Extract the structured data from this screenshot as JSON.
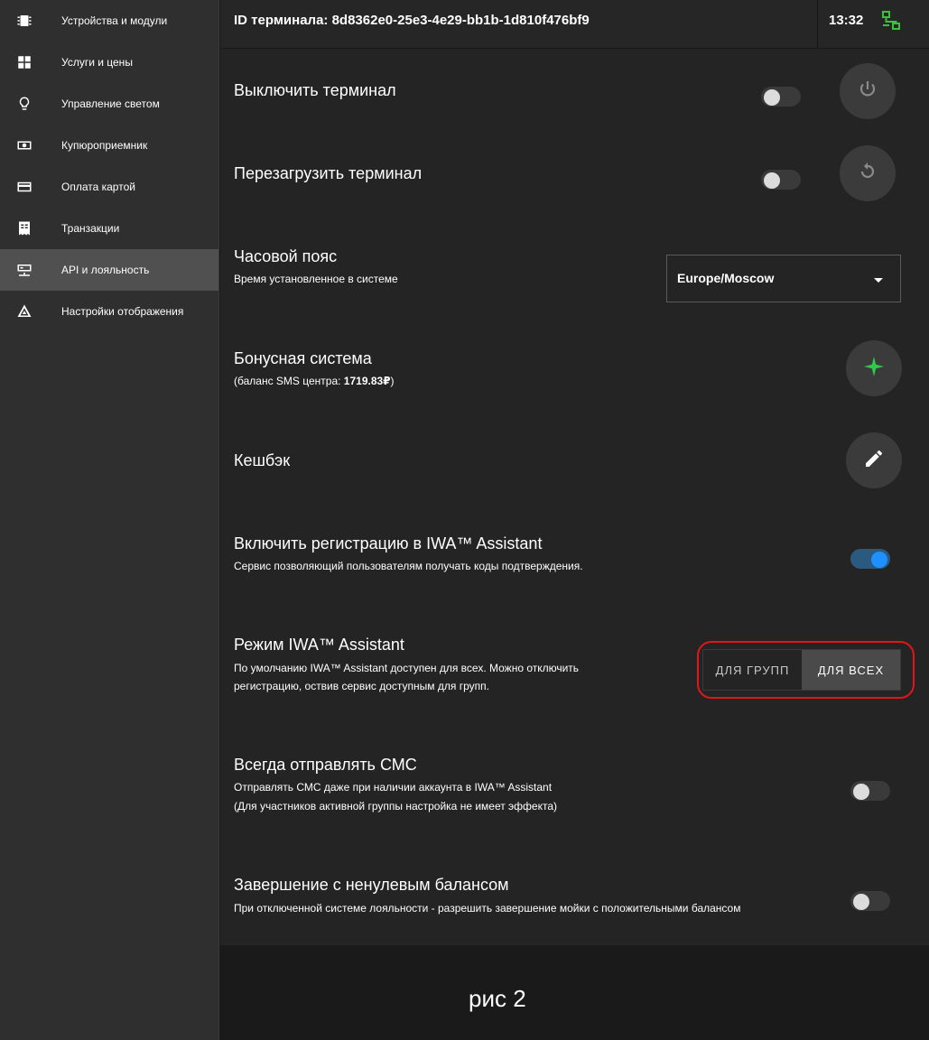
{
  "sidebar": {
    "items": [
      {
        "label": "Устройства и модули",
        "icon": "chip-icon"
      },
      {
        "label": "Услуги и цены",
        "icon": "grid-icon"
      },
      {
        "label": "Управление светом",
        "icon": "lightbulb-icon"
      },
      {
        "label": "Купюроприемник",
        "icon": "banknote-icon"
      },
      {
        "label": "Оплата картой",
        "icon": "credit-card-icon"
      },
      {
        "label": "Транзакции",
        "icon": "receipt-icon"
      },
      {
        "label": "API и лояльность",
        "icon": "api-icon",
        "active": true
      },
      {
        "label": "Настройки отображения",
        "icon": "display-settings-icon"
      }
    ]
  },
  "header": {
    "title": "ID терминала: 8d8362e0-25e3-4e29-bb1b-1d810f476bf9",
    "time": "13:32",
    "network_icon": "network-icon",
    "network_color": "#3fbf3f"
  },
  "settings": {
    "shutdown": {
      "title": "Выключить терминал",
      "toggle_on": false,
      "button_icon": "power-icon"
    },
    "reboot": {
      "title": "Перезагрузить терминал",
      "toggle_on": false,
      "button_icon": "restart-icon"
    },
    "timezone": {
      "title": "Часовой пояс",
      "subtitle": "Время установленное в системе",
      "value": "Europe/Moscow"
    },
    "bonus": {
      "title": "Бонусная система",
      "subtitle_prefix": "(баланс SMS центра: ",
      "balance": "1719.83₽",
      "subtitle_suffix": ")",
      "button_icon": "sparkle-icon",
      "accent": "#2ec84a"
    },
    "cashback": {
      "title": "Кешбэк",
      "button_icon": "pencil-icon"
    },
    "iwa_registration": {
      "title": "Включить регистрацию в IWA™ Assistant",
      "subtitle": "Сервис позволяющий пользователям получать коды подтверждения.",
      "toggle_on": true
    },
    "iwa_mode": {
      "title": "Режим IWA™ Assistant",
      "subtitle_line1": "По умолчанию IWA™ Assistant доступен для всех. Можно отключить",
      "subtitle_line2": "регистрацию, оствив сервис доступным для групп.",
      "options": [
        "ДЛЯ ГРУПП",
        "ДЛЯ ВСЕХ"
      ],
      "selected": "ДЛЯ ВСЕХ",
      "highlight_color": "#e0161b"
    },
    "always_sms": {
      "title": "Всегда отправлять СМС",
      "subtitle_line1": "Отправлять СМС даже при наличии аккаунта в IWA™ Assistant",
      "subtitle_line2": "(Для участников активной группы настройка не имеет эффекта)",
      "toggle_on": false
    },
    "nonzero_balance": {
      "title": "Завершение с ненулевым балансом",
      "subtitle": "При отключенной системе лояльности - разрешить завершение мойки с положительными балансом",
      "toggle_on": false
    }
  },
  "caption": "рис 2"
}
